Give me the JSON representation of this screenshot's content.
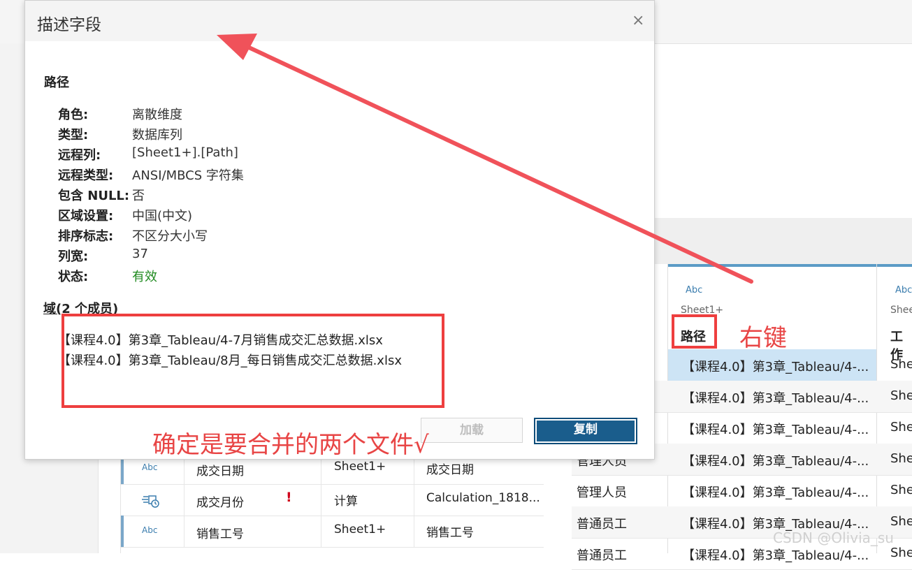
{
  "dialog": {
    "title": "描述字段",
    "field_name": "路径",
    "properties": [
      {
        "label": "角色:",
        "value": "离散维度"
      },
      {
        "label": "类型:",
        "value": "数据库列"
      },
      {
        "label": "远程列:",
        "value": "[Sheet1+].[Path]"
      },
      {
        "label": "远程类型:",
        "value": "ANSI/MBCS 字符集"
      },
      {
        "label": "包含 NULL:",
        "value": "否"
      },
      {
        "label": "区域设置:",
        "value": "中国(中文)"
      },
      {
        "label": "排序标志:",
        "value": "不区分大小写"
      },
      {
        "label": "列宽:",
        "value": "37"
      },
      {
        "label": "状态:",
        "value": "有效"
      }
    ],
    "domain_title": "域(2 个成员)",
    "domain_members": [
      "【课程4.0】第3章_Tableau/4-7月销售成交汇总数据.xlsx",
      "【课程4.0】第3章_Tableau/8月_每日销售成交汇总数据.xlsx"
    ],
    "load_label": "加载",
    "copy_label": "复制",
    "close_glyph": "×"
  },
  "annotations": {
    "right_click": "右键",
    "confirm": "确定是要合并的两个文件√",
    "colors": {
      "annotation": "#e84545",
      "valid": "#1f8a1f",
      "primary": "#1a5d8c"
    }
  },
  "meta_grid": {
    "rows": [
      {
        "type": "Abc",
        "name": "成交日期",
        "table": "Sheet1+",
        "remote": "成交日期",
        "warning": ""
      },
      {
        "type": "calc-date-icon",
        "name": "成交月份",
        "table": "计算",
        "remote": "Calculation_1818...",
        "warning": "!"
      },
      {
        "type": "Abc",
        "name": "销售工号",
        "table": "Sheet1+",
        "remote": "销售工号",
        "warning": ""
      }
    ]
  },
  "data_grid": {
    "headers": [
      {
        "type": "Abc",
        "source": "Sheet1+",
        "name": "路径"
      },
      {
        "type": "Abc",
        "source": "Shee",
        "name": "工作"
      }
    ],
    "rows": [
      {
        "a": "",
        "b": "【课程4.0】第3章_Tableau/4-...",
        "c": "She"
      },
      {
        "a": "",
        "b": "【课程4.0】第3章_Tableau/4-...",
        "c": "She"
      },
      {
        "a": "",
        "b": "【课程4.0】第3章_Tableau/4-...",
        "c": "She"
      },
      {
        "a": "管理人员",
        "b": "【课程4.0】第3章_Tableau/4-...",
        "c": "She"
      },
      {
        "a": "管理人员",
        "b": "【课程4.0】第3章_Tableau/4-...",
        "c": "She"
      },
      {
        "a": "普通员工",
        "b": "【课程4.0】第3章_Tableau/4-...",
        "c": "She"
      },
      {
        "a": "普通员工",
        "b": "【课程4.0】第3章_Tableau/4-...",
        "c": "She"
      }
    ]
  },
  "watermark": "CSDN @Olivia_su"
}
